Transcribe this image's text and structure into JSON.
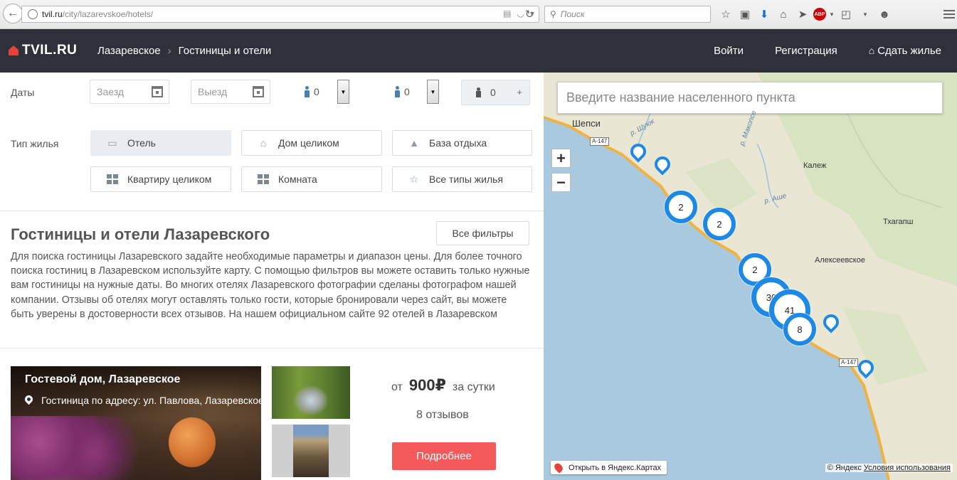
{
  "browser": {
    "url_host": "tvil.ru",
    "url_path": "/city/lazarevskoe/hotels/",
    "search_placeholder": "Поиск",
    "abp_label": "ABP"
  },
  "header": {
    "logo": "TVIL.RU",
    "breadcrumb": [
      "Лазаревское",
      "Гостиницы и отели"
    ],
    "nav": {
      "login": "Войти",
      "register": "Регистрация",
      "rent_out": "Сдать жилье"
    }
  },
  "filters": {
    "dates_label": "Даты",
    "checkin_placeholder": "Заезд",
    "checkout_placeholder": "Выезд",
    "adults_value": "0",
    "children_value": "0",
    "infants_value": "0",
    "type_label": "Тип жилья",
    "types": [
      {
        "label": "Отель",
        "icon": "hotel-icon",
        "active": true
      },
      {
        "label": "Дом целиком",
        "icon": "house-icon"
      },
      {
        "label": "База отдыха",
        "icon": "camp-icon"
      },
      {
        "label": "Квартиру целиком",
        "icon": "apartment-icon"
      },
      {
        "label": "Комната",
        "icon": "room-icon"
      },
      {
        "label": "Все типы жилья",
        "icon": "star-icon"
      }
    ]
  },
  "about": {
    "title": "Гостиницы и отели Лазаревского",
    "all_filters": "Все фильтры",
    "text": "Для поиска гостиницы Лазаревского задайте необходимые параметры и диапазон цены. Для более точного поиска гостиниц в Лазаревском используйте карту. С помощью фильтров вы можете оставить только нужные вам гостиницы на нужные даты. Во многих отелях Лазаревского фотографии сделаны фотографом нашей компании. Отзывы об отелях могут оставлять только гости, которые бронировали через сайт, вы можете быть уверены в достоверности всех отзывов. На нашем официальном сайте 92 отелей в Лазаревском"
  },
  "listing": {
    "title": "Гостевой дом, Лазаревское",
    "address": "Гостиница по адресу: ул. Павлова, Лазаревское",
    "price_prefix": "от",
    "price": "900₽",
    "price_suffix": "за сутки",
    "reviews": "8 отзывов",
    "details_button": "Подробнее"
  },
  "map": {
    "search_placeholder": "Введите название населенного пункта",
    "zoom_in": "+",
    "zoom_out": "−",
    "places": {
      "shepsi": "Шепси",
      "kalezh": "Калеж",
      "thagapsh": "Тхагапш",
      "alekseevskoe": "Алексеевское"
    },
    "rivers": {
      "shuyuk": "р. Шуюк",
      "makopse": "р. Макопсе",
      "ashe": "р. Аше"
    },
    "road_labels": [
      "А-147",
      "А-147"
    ],
    "clusters": [
      "2",
      "2",
      "2",
      "30",
      "41",
      "8"
    ],
    "open_in_yandex": "Открыть в Яндекс.Картах",
    "copyright": "© Яндекс",
    "terms": "Условия использования",
    "colors": {
      "sea": "#a9c9de",
      "land": "#e9e6d4",
      "forest": "#cfe0b8",
      "cluster": "#1e88e5",
      "road": "#f0b343"
    }
  }
}
